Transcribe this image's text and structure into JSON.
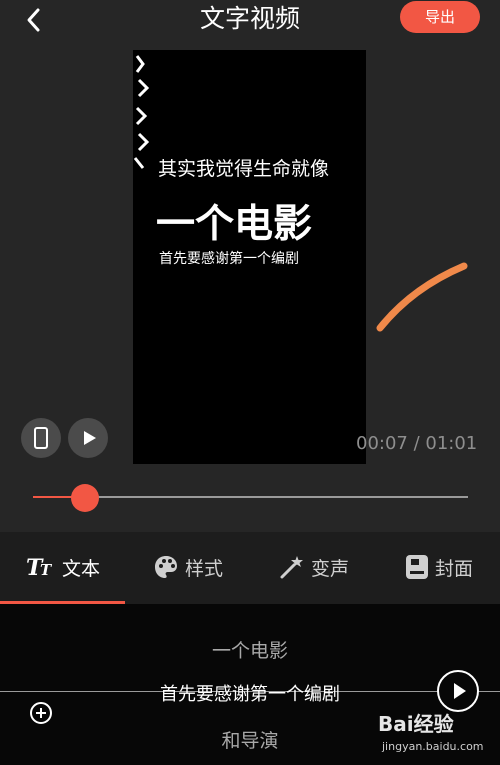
{
  "header": {
    "title": "文字视频",
    "export_label": "导出"
  },
  "preview": {
    "line1": "其实我觉得生命就像",
    "line2": "一个电影",
    "line3": "首先要感谢第一个编剧"
  },
  "player": {
    "time_display": "00:07 / 01:01",
    "progress_fraction": 0.12
  },
  "tabs": [
    {
      "label": "文本",
      "icon": "text-style-icon",
      "active": true
    },
    {
      "label": "样式",
      "icon": "palette-icon",
      "active": false
    },
    {
      "label": "变声",
      "icon": "magic-wand-icon",
      "active": false
    },
    {
      "label": "封面",
      "icon": "cover-icon",
      "active": false
    }
  ],
  "subtitles": {
    "prev": "一个电影",
    "current": "首先要感谢第一个编剧",
    "next": "和导演"
  },
  "watermark": {
    "logo": "Bai经验",
    "url": "jingyan.baidu.com"
  },
  "colors": {
    "accent": "#f25744",
    "background": "#262626",
    "bottom_panel": "#070707",
    "stroke": "#f0894a"
  }
}
